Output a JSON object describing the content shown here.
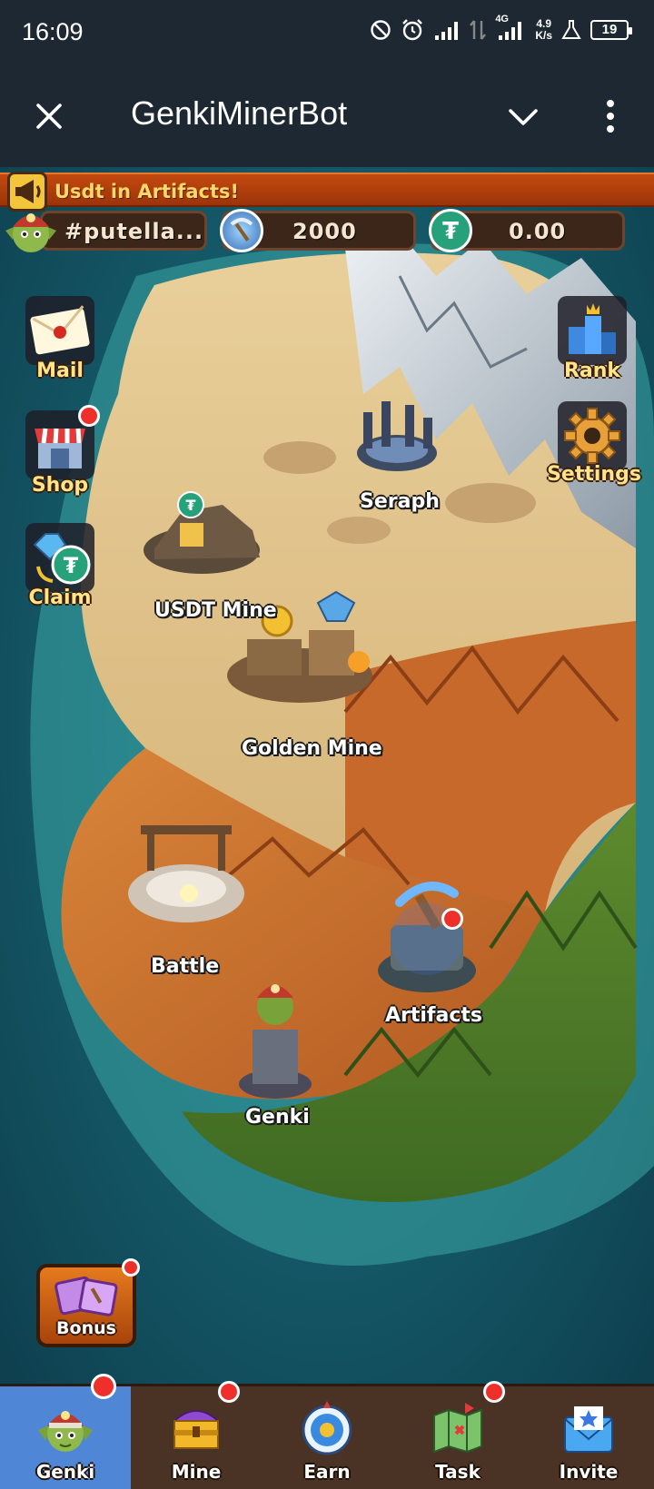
{
  "status_bar": {
    "time": "16:09",
    "network_type": "4G",
    "net_speed_value": "4.9",
    "net_speed_unit": "K/s",
    "battery": "19"
  },
  "title_bar": {
    "title": "GenkiMinerBot"
  },
  "announcement": {
    "text": "Usdt in Artifacts!"
  },
  "resources": {
    "username": "#putella...",
    "pickaxe_count": "2000",
    "usdt_balance": "0.00"
  },
  "side_buttons": {
    "mail": "Mail",
    "shop": "Shop",
    "claim": "Claim",
    "rank": "Rank",
    "settings": "Settings"
  },
  "places": {
    "seraph": "Seraph",
    "usdt_mine": "USDT Mine",
    "golden_mine": "Golden Mine",
    "battle": "Battle",
    "artifacts": "Artifacts",
    "genki": "Genki"
  },
  "bonus": {
    "label": "Bonus"
  },
  "bottom_nav": [
    {
      "label": "Genki",
      "icon": "goblin-icon",
      "active": true,
      "badge": true
    },
    {
      "label": "Mine",
      "icon": "treasure-chest-icon",
      "active": false,
      "badge": true
    },
    {
      "label": "Earn",
      "icon": "coin-icon",
      "active": false,
      "badge": false
    },
    {
      "label": "Task",
      "icon": "map-icon",
      "active": false,
      "badge": true
    },
    {
      "label": "Invite",
      "icon": "envelope-icon",
      "active": false,
      "badge": false
    }
  ],
  "colors": {
    "background": "#1e2833",
    "announcement_bg": "#b23e0c",
    "announcement_text": "#ffd86a",
    "active_tab": "#4f86d6",
    "nav_bg": "#4a3225",
    "badge_red": "#ef2f2a",
    "label_yellow": "#ffe48a",
    "usdt_green": "#27a17a"
  }
}
